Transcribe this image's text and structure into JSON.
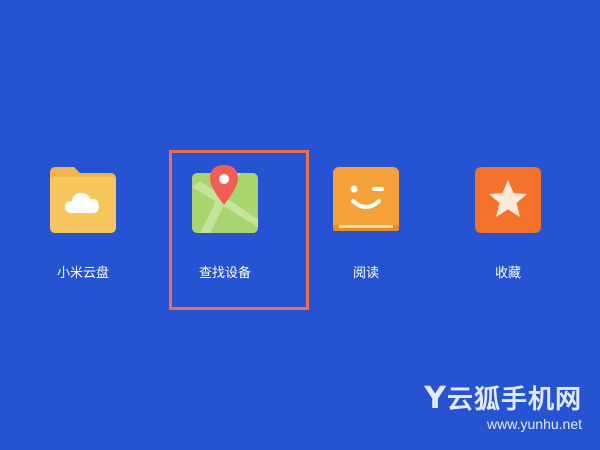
{
  "apps": [
    {
      "label": "小米云盘",
      "icon": "cloud-folder-icon"
    },
    {
      "label": "查找设备",
      "icon": "map-pin-icon"
    },
    {
      "label": "阅读",
      "icon": "smiley-book-icon"
    },
    {
      "label": "收藏",
      "icon": "star-icon"
    }
  ],
  "watermark": {
    "letter": "Y",
    "name": "云狐手机网",
    "url": "www.yunhu.net"
  },
  "colors": {
    "background": "#2553d2",
    "highlight": "#e8704f",
    "folder": "#f7c05d",
    "map": "#a8d56e",
    "pin": "#f05f55",
    "book": "#f4a13a",
    "star": "#f4722c"
  }
}
